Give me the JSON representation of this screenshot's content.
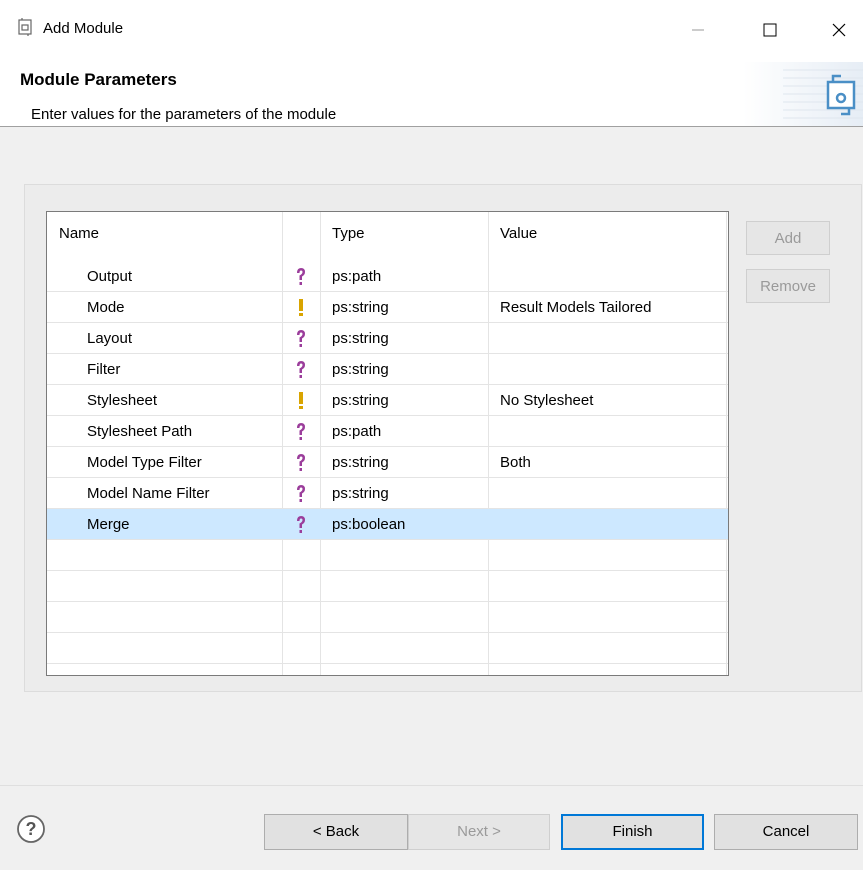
{
  "window": {
    "title": "Add Module",
    "minimize_icon": "minimize-icon",
    "maximize_icon": "maximize-icon",
    "close_icon": "close-icon"
  },
  "header": {
    "title": "Module Parameters",
    "description": "Enter values for the parameters of the module"
  },
  "table": {
    "columns": [
      "Name",
      "",
      "Type",
      "Value"
    ],
    "rows": [
      {
        "name": "Output",
        "icon": "question-icon",
        "type": "ps:path",
        "value": ""
      },
      {
        "name": "Mode",
        "icon": "exclamation-icon",
        "type": "ps:string",
        "value": "Result Models Tailored"
      },
      {
        "name": "Layout",
        "icon": "question-icon",
        "type": "ps:string",
        "value": ""
      },
      {
        "name": "Filter",
        "icon": "question-icon",
        "type": "ps:string",
        "value": ""
      },
      {
        "name": "Stylesheet",
        "icon": "exclamation-icon",
        "type": "ps:string",
        "value": "No Stylesheet"
      },
      {
        "name": "Stylesheet Path",
        "icon": "question-icon",
        "type": "ps:path",
        "value": ""
      },
      {
        "name": "Model Type Filter",
        "icon": "question-icon",
        "type": "ps:string",
        "value": "Both"
      },
      {
        "name": "Model Name Filter",
        "icon": "question-icon",
        "type": "ps:string",
        "value": ""
      },
      {
        "name": "Merge",
        "icon": "question-icon",
        "type": "ps:boolean",
        "value": "",
        "selected": true
      }
    ]
  },
  "side_buttons": {
    "add": "Add",
    "remove": "Remove"
  },
  "footer": {
    "back": "< Back",
    "next": "Next >",
    "finish": "Finish",
    "cancel": "Cancel",
    "help_icon": "help-icon"
  },
  "colors": {
    "question_icon": "#9b3d9b",
    "exclamation_icon": "#d9a400",
    "selection": "#cde8ff",
    "default_button_border": "#0078d7"
  }
}
